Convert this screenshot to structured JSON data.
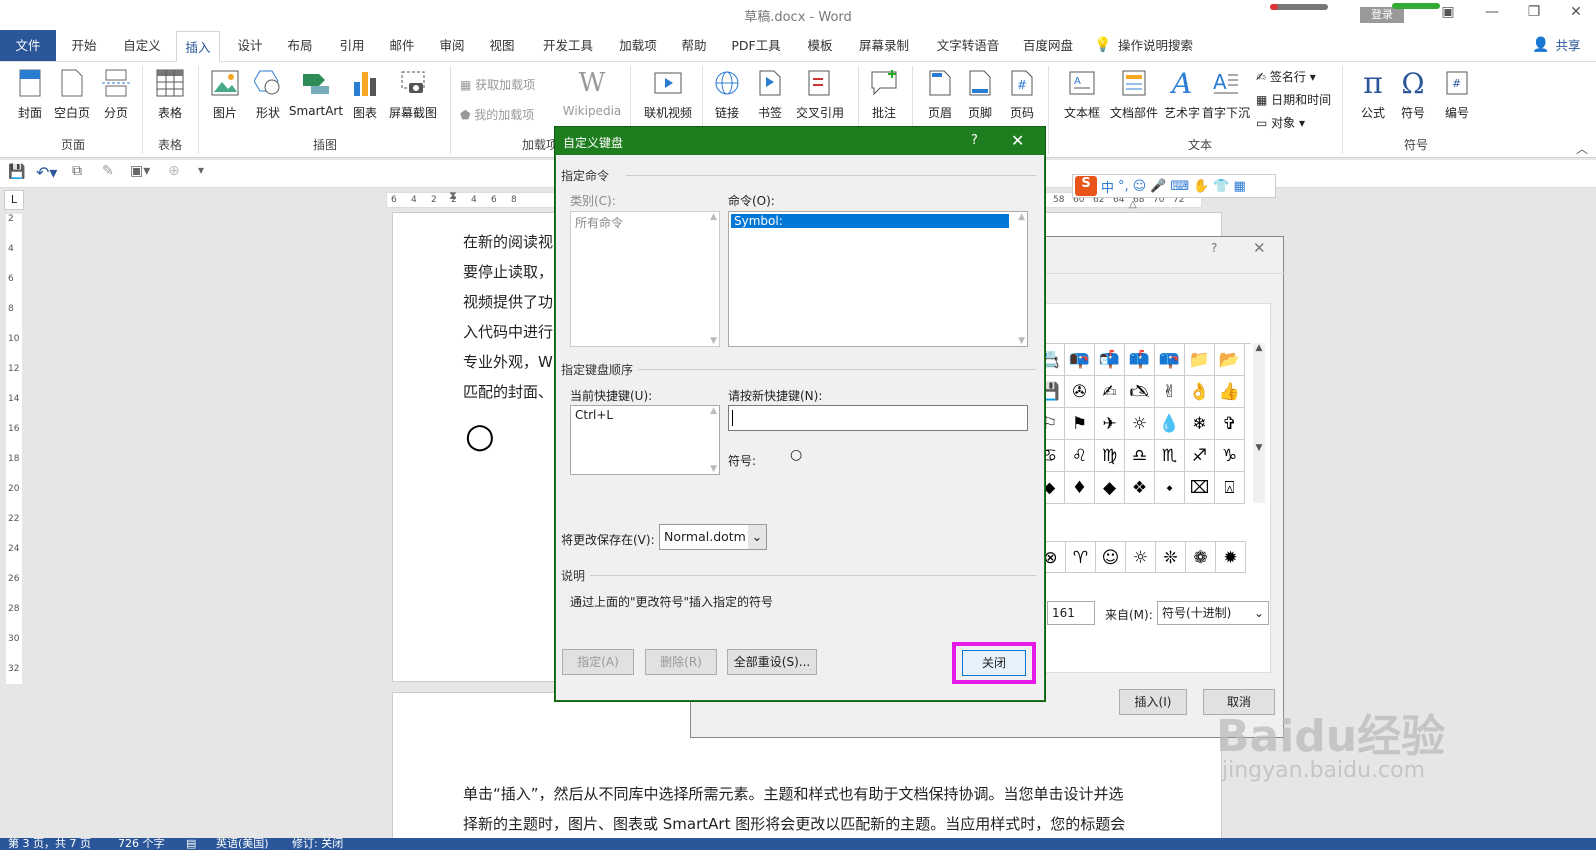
{
  "window": {
    "title": "草稿.docx - Word",
    "login": "登录"
  },
  "tabs": [
    {
      "label": "文件"
    },
    {
      "label": "开始"
    },
    {
      "label": "自定义"
    },
    {
      "label": "插入"
    },
    {
      "label": "设计"
    },
    {
      "label": "布局"
    },
    {
      "label": "引用"
    },
    {
      "label": "邮件"
    },
    {
      "label": "审阅"
    },
    {
      "label": "视图"
    },
    {
      "label": "开发工具"
    },
    {
      "label": "加载项"
    },
    {
      "label": "帮助"
    },
    {
      "label": "PDF工具"
    },
    {
      "label": "模板"
    },
    {
      "label": "屏幕录制"
    },
    {
      "label": "文字转语音"
    },
    {
      "label": "百度网盘"
    }
  ],
  "tell_me": "操作说明搜索",
  "share": "共享",
  "ribbon": {
    "buttons": [
      {
        "label": "封面"
      },
      {
        "label": "空白页"
      },
      {
        "label": "分页"
      },
      {
        "label": "表格"
      },
      {
        "label": "图片"
      },
      {
        "label": "形状"
      },
      {
        "label": "SmartArt"
      },
      {
        "label": "图表"
      },
      {
        "label": "屏幕截图"
      },
      {
        "label": "Wikipedia"
      },
      {
        "label": "联机视频"
      },
      {
        "label": "链接"
      },
      {
        "label": "书签"
      },
      {
        "label": "交叉引用"
      },
      {
        "label": "批注"
      },
      {
        "label": "页眉"
      },
      {
        "label": "页脚"
      },
      {
        "label": "页码"
      },
      {
        "label": "文本框"
      },
      {
        "label": "文档部件"
      },
      {
        "label": "艺术字"
      },
      {
        "label": "首字下沉"
      },
      {
        "label": "公式"
      },
      {
        "label": "符号"
      },
      {
        "label": "编号"
      }
    ],
    "addins": [
      "获取加载项",
      "我的加载项"
    ],
    "text_small": [
      "签名行",
      "日期和时间",
      "对象"
    ],
    "groups": [
      "页面",
      "表格",
      "插图",
      "加载项",
      "文本",
      "符号"
    ]
  },
  "ruler": {
    "left_ticks": [
      "6",
      "4",
      "2",
      "2",
      "4",
      "6",
      "8"
    ],
    "right_ticks": [
      "58",
      "60",
      "62",
      "64",
      "68",
      "70",
      "72"
    ]
  },
  "vruler": [
    "2",
    "4",
    "6",
    "8",
    "10",
    "12",
    "14",
    "16",
    "18",
    "20",
    "22",
    "24",
    "26",
    "28",
    "30",
    "32"
  ],
  "document": {
    "lines": [
      "在新的阅读视",
      "要停止读取，",
      "视频提供了功",
      "入代码中进行",
      "专业外观，W",
      "匹配的封面、"
    ],
    "symbol": "○",
    "page2_line1": "单击“插入”，然后从不同库中选择所需元素。主题和样式也有助于文档保持协调。当您单击设计并选",
    "page2_line2": "择新的主题时，图片、图表或 SmartArt 图形将会更改以匹配新的主题。当应用样式时，您的标题会"
  },
  "status": {
    "page": "第 3 页，共 7 页",
    "words": "726 个字",
    "lang": "英语(美国)",
    "track": "修订: 关闭"
  },
  "ime": {
    "mode": "中"
  },
  "symbol_dialog": {
    "help": "?",
    "close": "✕",
    "grid": [
      [
        "📇",
        "📭",
        "📬",
        "📫",
        "📪",
        "📁",
        "📂"
      ],
      [
        "💾",
        "✇",
        "✍",
        "🖎",
        "✌",
        "👌",
        "👍"
      ],
      [
        "⚐",
        "⚑",
        "✈",
        "☼",
        "💧",
        "❄",
        "✞"
      ],
      [
        "♋",
        "♌",
        "♍",
        "♎",
        "♏",
        "♐",
        "♑"
      ],
      [
        "⬥",
        "♦",
        "◆",
        "❖",
        "⬩",
        "⌧",
        "⍓"
      ]
    ],
    "recent": [
      "⊗",
      "♈",
      "☺",
      "☼",
      "❊",
      "❁",
      "✹"
    ],
    "code_value": "161",
    "from_label": "来自(M):",
    "from_value": "符号(十进制)",
    "insert": "插入(I)",
    "cancel": "取消"
  },
  "keyboard_dialog": {
    "title": "自定义键盘",
    "help": "?",
    "close": "✕",
    "specify_command": "指定命令",
    "categories_label": "类别(C):",
    "categories_value": "所有命令",
    "commands_label": "命令(O):",
    "commands_value": "Symbol:",
    "key_sequence": "指定键盘顺序",
    "current_keys_label": "当前快捷键(U):",
    "current_keys_value": "Ctrl+L",
    "new_key_label": "请按新快捷键(N):",
    "new_key_value": "",
    "symbol_label": "符号:",
    "symbol_value": "○",
    "save_in_label": "将更改保存在(V):",
    "save_in_value": "Normal.dotm",
    "description_label": "说明",
    "description_text": "通过上面的\"更改符号\"插入指定的符号",
    "assign": "指定(A)",
    "remove": "删除(R)",
    "reset_all": "全部重设(S)...",
    "close_button": "关闭",
    "highlight_color": "#e619e6"
  },
  "watermark": {
    "brand": "Baidu经验",
    "url": "jingyan.baidu.com"
  }
}
